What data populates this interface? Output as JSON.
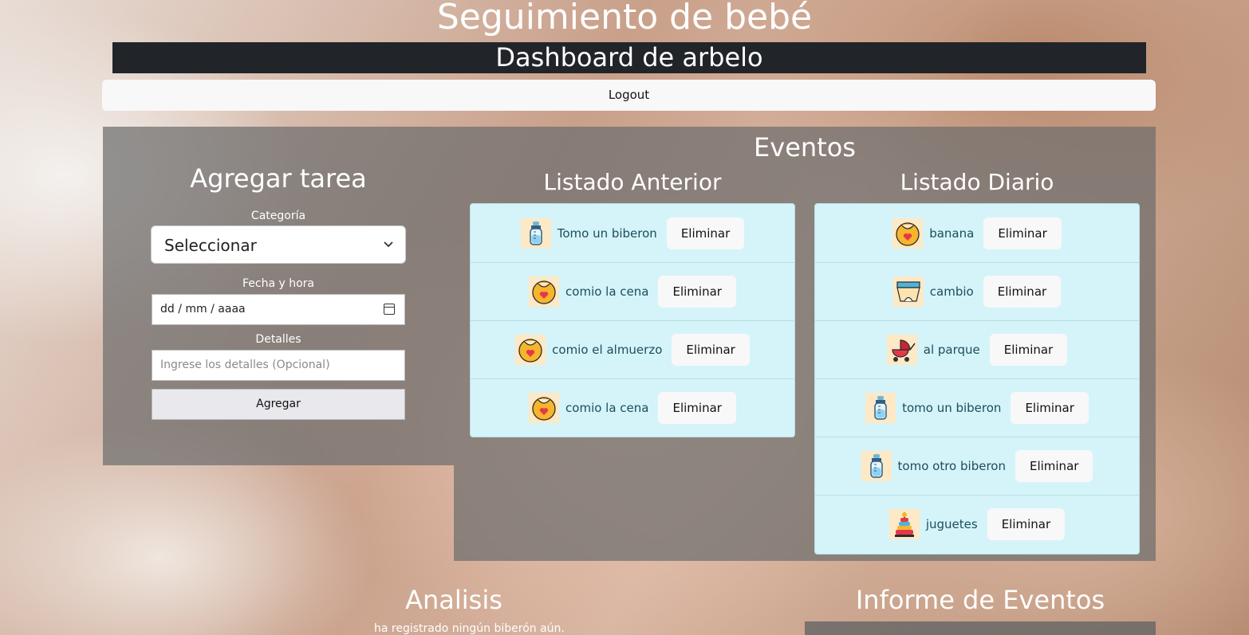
{
  "header": {
    "title": "Seguimiento de bebé",
    "subtitle": "Dashboard de arbelo",
    "logout_label": "Logout"
  },
  "add_task": {
    "heading": "Agregar tarea",
    "category_label": "Categoría",
    "category_value": "Seleccionar",
    "datetime_label": "Fecha y hora",
    "datetime_value": "dd / mm / aaaa",
    "details_label": "Detalles",
    "details_placeholder": "Ingrese los detalles (Opcional)",
    "submit_label": "Agregar"
  },
  "events": {
    "heading": "Eventos",
    "previous": {
      "heading": "Listado Anterior",
      "items": [
        {
          "icon": "bottle-icon",
          "text": "Tomo un biberon",
          "action": "Eliminar"
        },
        {
          "icon": "bib-icon",
          "text": "comio la cena",
          "action": "Eliminar"
        },
        {
          "icon": "bib-icon",
          "text": "comio el almuerzo",
          "action": "Eliminar"
        },
        {
          "icon": "bib-icon",
          "text": "comio la cena",
          "action": "Eliminar"
        }
      ]
    },
    "daily": {
      "heading": "Listado Diario",
      "items": [
        {
          "icon": "bib-icon",
          "text": "banana",
          "action": "Eliminar"
        },
        {
          "icon": "diaper-icon",
          "text": "cambio",
          "action": "Eliminar"
        },
        {
          "icon": "stroller-icon",
          "text": "al parque",
          "action": "Eliminar"
        },
        {
          "icon": "bottle-icon",
          "text": "tomo un biberon",
          "action": "Eliminar"
        },
        {
          "icon": "bottle-icon",
          "text": "tomo otro biberon",
          "action": "Eliminar"
        },
        {
          "icon": "toy-icon",
          "text": "juguetes",
          "action": "Eliminar"
        }
      ]
    }
  },
  "analysis": {
    "heading": "Analisis",
    "note": "ha registrado ningún biberón aún."
  },
  "report": {
    "heading": "Informe de Eventos"
  },
  "colors": {
    "dark_bar": "#212529",
    "list_bg": "#d5f4fa",
    "icon_bg": "#fde9c5"
  }
}
